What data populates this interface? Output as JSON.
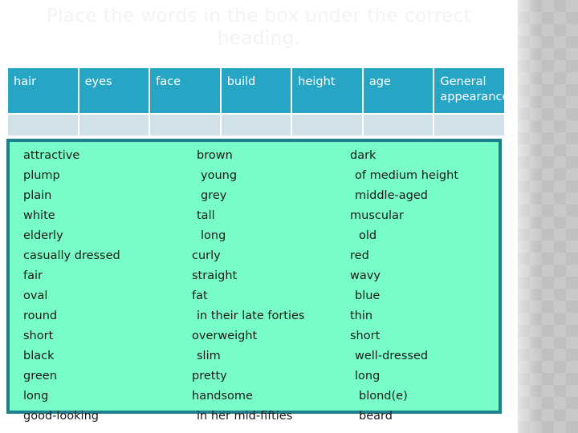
{
  "slide": {
    "title": "Place the words in the box under the correct heading.",
    "title_color": "#f3f3f3",
    "background_color": "#ffffff",
    "pattern_color": "#c9c9c9"
  },
  "table": {
    "header_bg": "#27a5c4",
    "header_text_color": "#ffffff",
    "cell_bg": "#d2e0e8",
    "headers": [
      "hair",
      "eyes",
      "face",
      "build",
      "height",
      "age",
      "General appearance"
    ],
    "answer_row": [
      "",
      "",
      "",
      "",
      "",
      "",
      ""
    ]
  },
  "word_bank": {
    "background_color": "#79fdc8",
    "border_color": "#1d7f8c",
    "text_color": "#1a1a1a",
    "columns": [
      {
        "name": "column-1",
        "words": [
          {
            "text": "attractive",
            "indent": 0
          },
          {
            "text": "plump",
            "indent": 0
          },
          {
            "text": "plain",
            "indent": 0
          },
          {
            "text": "white",
            "indent": 0
          },
          {
            "text": "elderly",
            "indent": 0
          },
          {
            "text": "casually dressed",
            "indent": 0
          },
          {
            "text": "fair",
            "indent": 0
          },
          {
            "text": "oval",
            "indent": 0
          },
          {
            "text": "round",
            "indent": 0
          },
          {
            "text": "short",
            "indent": 0
          },
          {
            "text": "black",
            "indent": 0
          },
          {
            "text": "green",
            "indent": 0
          },
          {
            "text": "long",
            "indent": 0
          },
          {
            "text": "good-looking",
            "indent": 0
          }
        ]
      },
      {
        "name": "column-2",
        "words": [
          {
            "text": "brown",
            "indent": 1
          },
          {
            "text": "young",
            "indent": 2
          },
          {
            "text": "grey",
            "indent": 2
          },
          {
            "text": "tall",
            "indent": 1
          },
          {
            "text": "long",
            "indent": 2
          },
          {
            "text": "curly",
            "indent": 0
          },
          {
            "text": "straight",
            "indent": 0
          },
          {
            "text": "fat",
            "indent": 0
          },
          {
            "text": "in their late forties",
            "indent": 1
          },
          {
            "text": "overweight",
            "indent": 0
          },
          {
            "text": "slim",
            "indent": 1
          },
          {
            "text": "pretty",
            "indent": 0
          },
          {
            "text": "handsome",
            "indent": 0
          },
          {
            "text": "in her mid-fifties",
            "indent": 1
          }
        ]
      },
      {
        "name": "column-3",
        "words": [
          {
            "text": "dark",
            "indent": 0
          },
          {
            "text": "of medium height",
            "indent": 1
          },
          {
            "text": "middle-aged",
            "indent": 1
          },
          {
            "text": "muscular",
            "indent": 0
          },
          {
            "text": "old",
            "indent": 2
          },
          {
            "text": "red",
            "indent": 0
          },
          {
            "text": "wavy",
            "indent": 0
          },
          {
            "text": "blue",
            "indent": 1
          },
          {
            "text": "thin",
            "indent": 0
          },
          {
            "text": "short",
            "indent": 0
          },
          {
            "text": "well-dressed",
            "indent": 1
          },
          {
            "text": "long",
            "indent": 1
          },
          {
            "text": "blond(e)",
            "indent": 2
          },
          {
            "text": "beard",
            "indent": 2
          }
        ]
      }
    ]
  }
}
